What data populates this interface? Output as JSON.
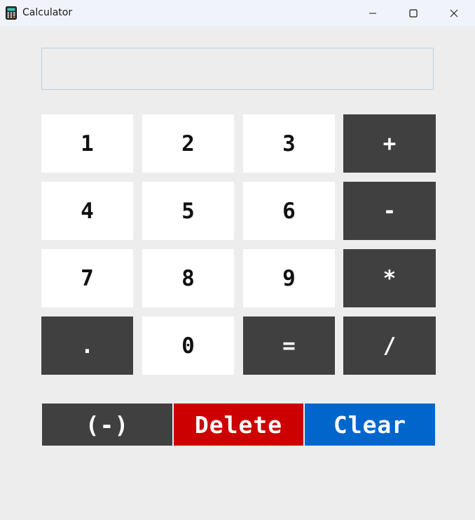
{
  "window": {
    "title": "Calculator"
  },
  "display": {
    "value": ""
  },
  "keys": {
    "k1": "1",
    "k2": "2",
    "k3": "3",
    "plus": "+",
    "k4": "4",
    "k5": "5",
    "k6": "6",
    "minus": "-",
    "k7": "7",
    "k8": "8",
    "k9": "9",
    "multiply": "*",
    "dot": ".",
    "k0": "0",
    "equals": "=",
    "divide": "/"
  },
  "actions": {
    "negate": "(-)",
    "delete": "Delete",
    "clear": "Clear"
  },
  "colors": {
    "dark_key": "#404040",
    "light_key": "#ffffff",
    "delete": "#cc0000",
    "clear": "#0066cc"
  },
  "icons": [
    "calculator-app-icon",
    "minimize-icon",
    "maximize-icon",
    "close-icon"
  ]
}
